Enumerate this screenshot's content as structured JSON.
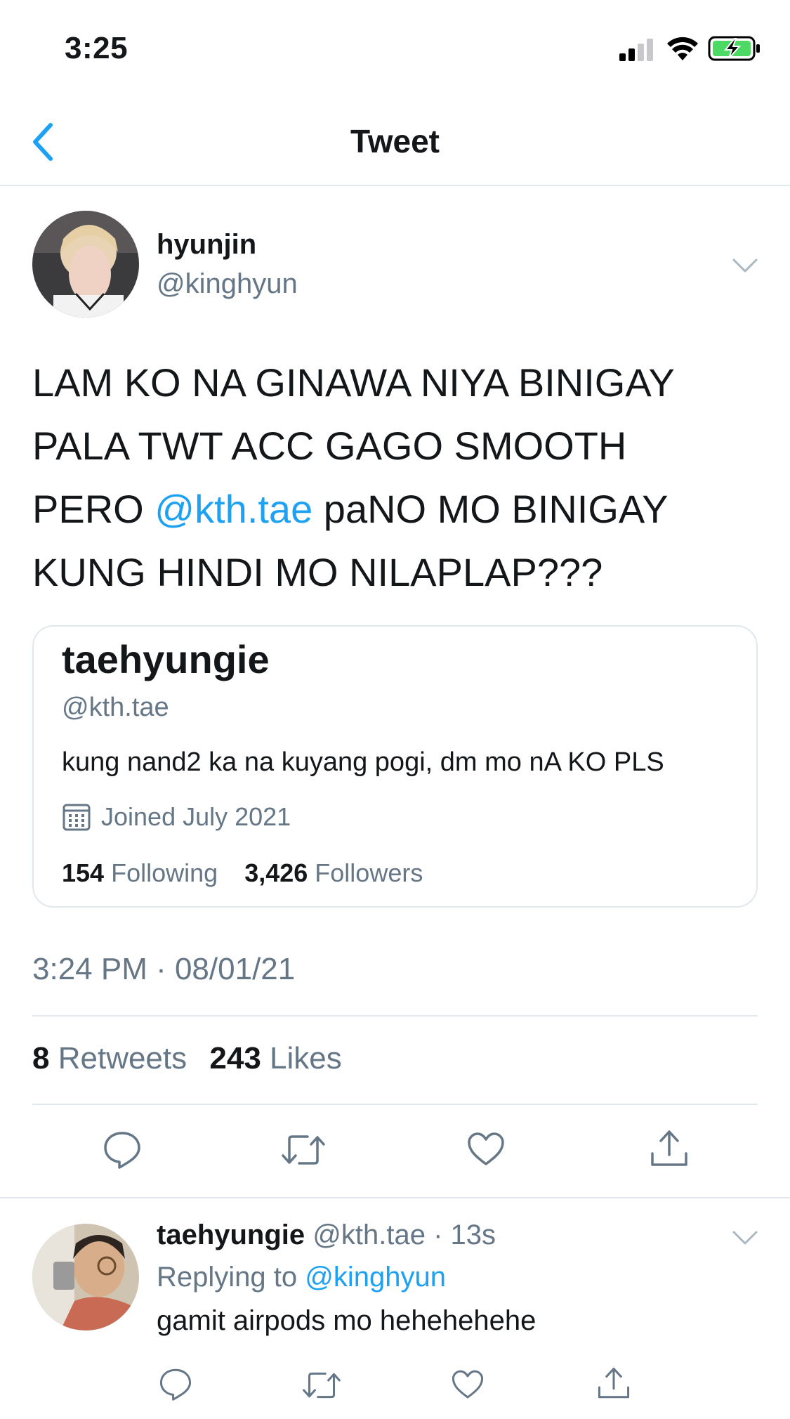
{
  "status_bar": {
    "time": "3:25"
  },
  "nav": {
    "title": "Tweet"
  },
  "tweet": {
    "author_name": "hyunjin",
    "author_handle": "@kinghyun",
    "text_before": "LAM KO NA GINAWA NIYA BINIGAY PALA TWT ACC GAGO SMOOTH PERO ",
    "mention": "@kth.tae",
    "text_after": " paNO MO BINIGAY KUNG HINDI MO NILAPLAP???",
    "timestamp": "3:24 PM · 08/01/21",
    "retweets_count": "8",
    "retweets_label": "Retweets",
    "likes_count": "243",
    "likes_label": "Likes"
  },
  "profile_card": {
    "name": "taehyungie",
    "handle": "@kth.tae",
    "bio": "kung nand2 ka na kuyang pogi, dm mo nA KO PLS",
    "joined": "Joined July 2021",
    "following_count": "154",
    "following_label": "Following",
    "followers_count": "3,426",
    "followers_label": "Followers"
  },
  "reply": {
    "author_name": "taehyungie",
    "meta": "@kth.tae · 13s",
    "replying_label": "Replying to",
    "replying_handle": "@kinghyun",
    "text": "gamit airpods mo hehehehehe"
  },
  "icons": [
    "back-chevron-icon",
    "caret-down-icon",
    "reply-icon",
    "retweet-icon",
    "like-icon",
    "share-icon",
    "calendar-icon"
  ],
  "colors": {
    "accent": "#1da1f2",
    "secondary_text": "#657786",
    "divider": "#e1e8ed",
    "battery_charging": "#4cd964"
  }
}
